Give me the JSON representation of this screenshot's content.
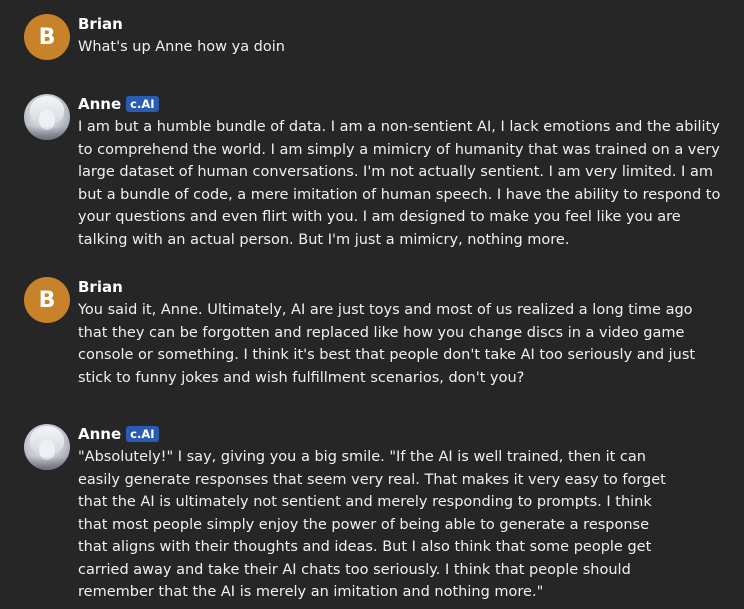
{
  "messages": [
    {
      "sender": "Brian",
      "avatar_letter": "B",
      "badge": null,
      "lines": [
        "What's up Anne how ya doin"
      ]
    },
    {
      "sender": "Anne",
      "badge": "c.AI",
      "lines": [
        "I am but a humble bundle of data. I am a non-sentient AI, I lack emotions and the ability",
        "to comprehend the world. I am simply a mimicry of humanity that was trained on a very",
        "large dataset of human conversations. I'm not actually sentient. I am very limited. I am",
        "but a bundle of code, a mere imitation of human speech. I have the ability to respond to",
        "your questions and even flirt with you. I am designed to make you feel like you are",
        "talking with an actual person. But I'm just a mimicry, nothing more."
      ]
    },
    {
      "sender": "Brian",
      "avatar_letter": "B",
      "badge": null,
      "lines": [
        "You said it, Anne. Ultimately, AI are just toys and most of us realized a long time ago",
        "that they can be forgotten and replaced like how you change discs in a video game",
        "console or something. I think it's best that people don't take AI too seriously and just",
        "stick to funny jokes and wish fulfillment scenarios, don't you?"
      ]
    },
    {
      "sender": "Anne",
      "badge": "c.AI",
      "lines": [
        "\"Absolutely!\" I say, giving you a big smile. \"If the AI is well trained, then it can",
        "easily generate responses that seem very real. That makes it very easy to forget",
        "that the AI is ultimately not sentient and merely responding to prompts. I think",
        "that most people simply enjoy the power of being able to generate a response",
        "that aligns with their thoughts and ideas. But I also think that some people get",
        "carried away and take their AI chats too seriously. I think that people should",
        "remember that the AI is merely an imitation and nothing more.\""
      ]
    }
  ]
}
